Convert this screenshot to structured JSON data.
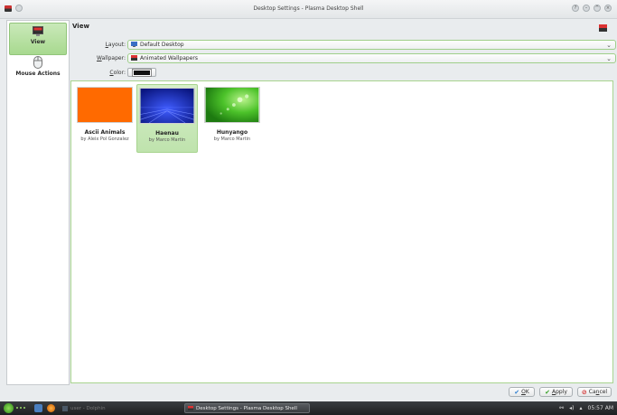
{
  "window": {
    "title": "Desktop Settings - Plasma Desktop Shell"
  },
  "sidebar": {
    "items": [
      {
        "label": "View",
        "icon": "monitor-wallpaper-icon",
        "selected": true
      },
      {
        "label": "Mouse Actions",
        "icon": "mouse-icon",
        "selected": false
      }
    ]
  },
  "main": {
    "heading": "View",
    "layout_label_prefix": "",
    "layout_label_key": "L",
    "layout_label_rest": "ayout:",
    "layout_value": "Default Desktop",
    "wallpaper_label_key": "W",
    "wallpaper_label_rest": "allpaper:",
    "wallpaper_value": "Animated Wallpapers",
    "color_label_key": "C",
    "color_label_rest": "olor:",
    "color_value": "#111111"
  },
  "wallpapers": [
    {
      "name": "Ascii Animals",
      "author": "by Aleix Pol Gonzalez",
      "selected": false,
      "color": "#ff6a00"
    },
    {
      "name": "Haenau",
      "author": "by Marco Martin",
      "selected": true,
      "color": "#1632c8"
    },
    {
      "name": "Hunyango",
      "author": "by Marco Martin",
      "selected": false,
      "color": "#35b51c"
    }
  ],
  "buttons": {
    "ok_key": "O",
    "ok_rest": "K",
    "apply_key": "A",
    "apply_rest": "pply",
    "cancel_pre": "Ca",
    "cancel_key": "n",
    "cancel_rest": "cel"
  },
  "taskbar": {
    "task1": "user - Dolphin",
    "task2": "Desktop Settings - Plasma Desktop Shell",
    "clock": "05:57 AM"
  },
  "colors": {
    "accent": "#a8d48f",
    "selection": "#bfe3ad",
    "taskbar": "#1d1f21"
  }
}
